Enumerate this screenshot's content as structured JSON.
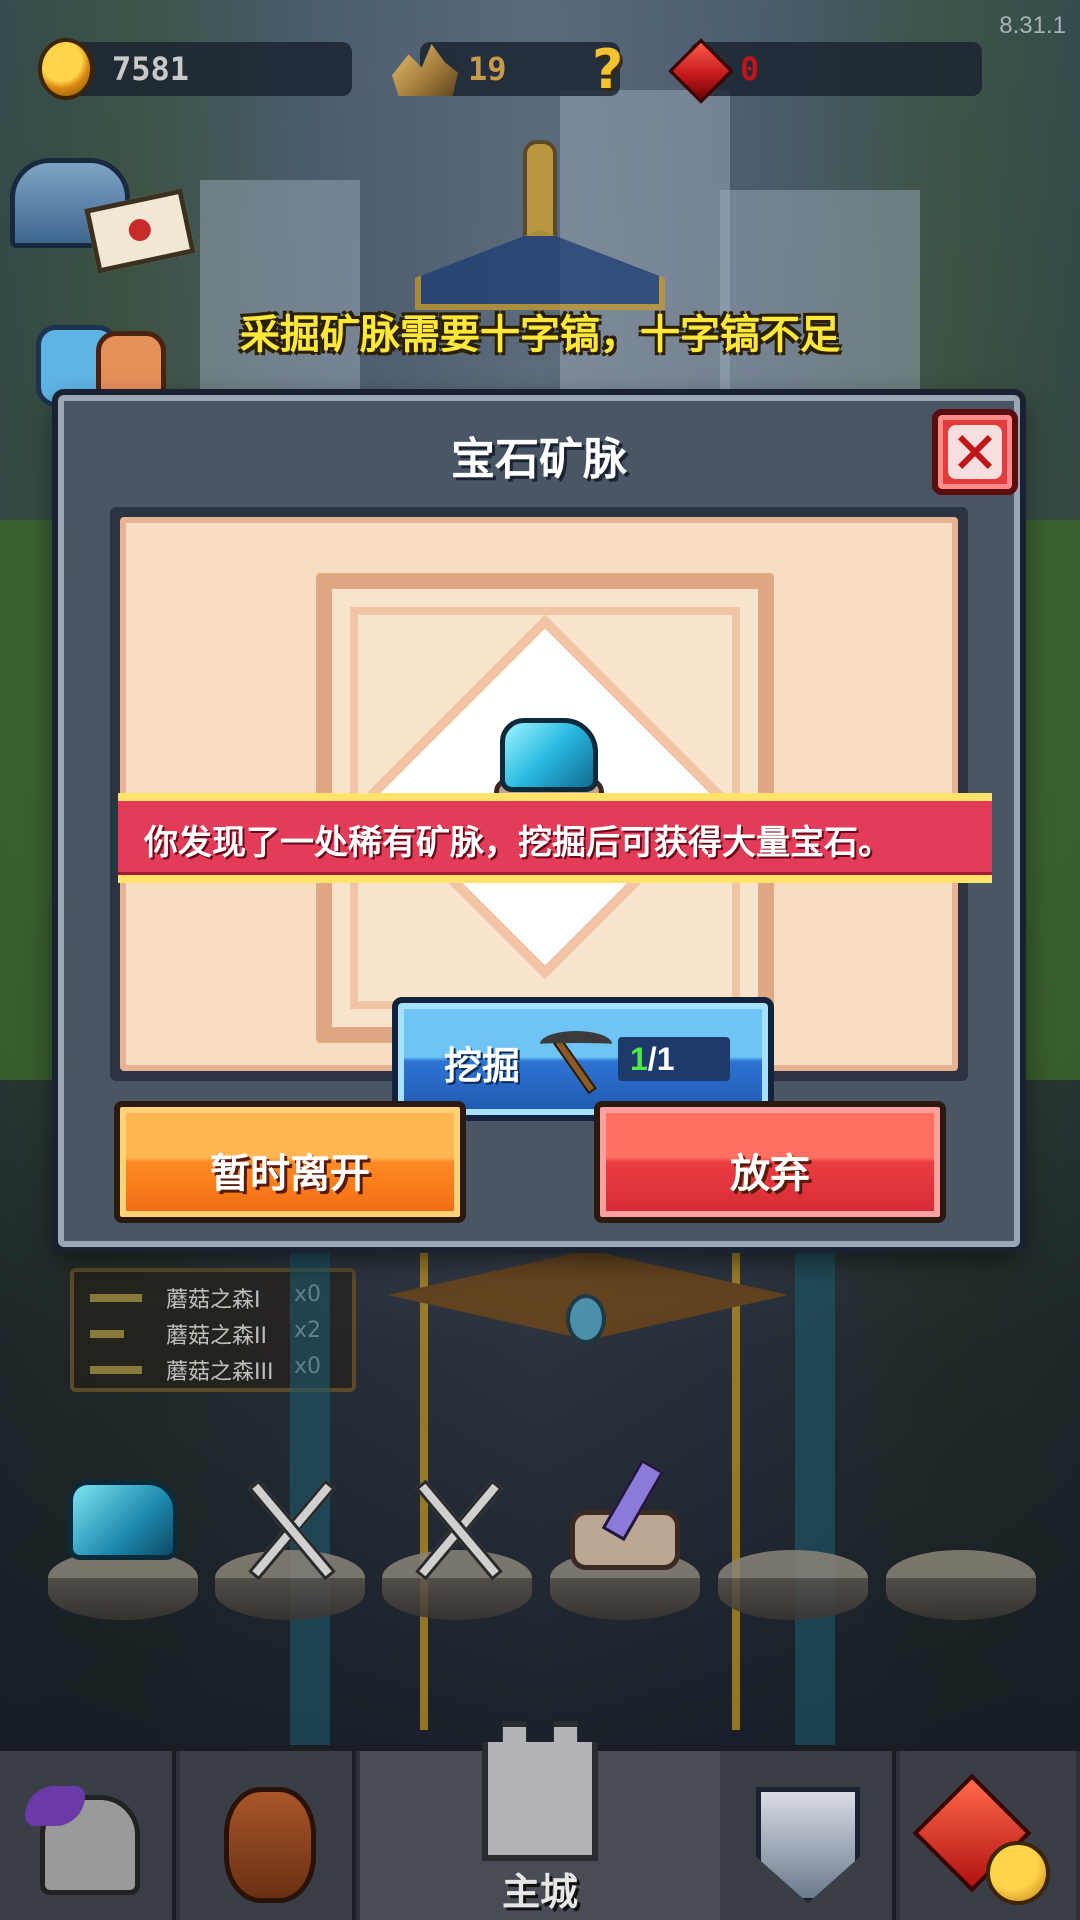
{
  "version": "8.31.1",
  "resources": {
    "coins": "7581",
    "ore": "19",
    "gems": "0"
  },
  "warning": "采掘矿脉需要十字镐，十字镐不足",
  "dialog": {
    "title": "宝石矿脉",
    "description": "你发现了一处稀有矿脉，挖掘后可获得大量宝石。",
    "dig": {
      "label": "挖掘",
      "have": "1",
      "total": "/1"
    },
    "leave_label": "暂时离开",
    "abandon_label": "放弃"
  },
  "quests": [
    {
      "name": "蘑菇之森I",
      "count": "x0"
    },
    {
      "name": "蘑菇之森II",
      "count": "x2"
    },
    {
      "name": "蘑菇之森III",
      "count": "x0"
    }
  ],
  "nav": {
    "main_label": "主城"
  },
  "icons": {
    "coin": "coin-icon",
    "ore": "ore-icon",
    "help": "question-icon",
    "gem": "gem-icon",
    "close": "close-icon",
    "pickaxe": "pickaxe-icon",
    "mailbox": "mailbox-icon",
    "friends": "friends-icon",
    "heroes": "helmet-icon",
    "tavern": "barrel-icon",
    "castle": "castle-icon",
    "battle": "shield-icon",
    "shop": "shop-icon"
  },
  "colors": {
    "warning_text": "#ffe83a",
    "pickaxe_have": "#4eea4a",
    "leave_button": "#ff8a24",
    "abandon_button": "#ec3c42",
    "dig_button": "#2f74d2"
  }
}
